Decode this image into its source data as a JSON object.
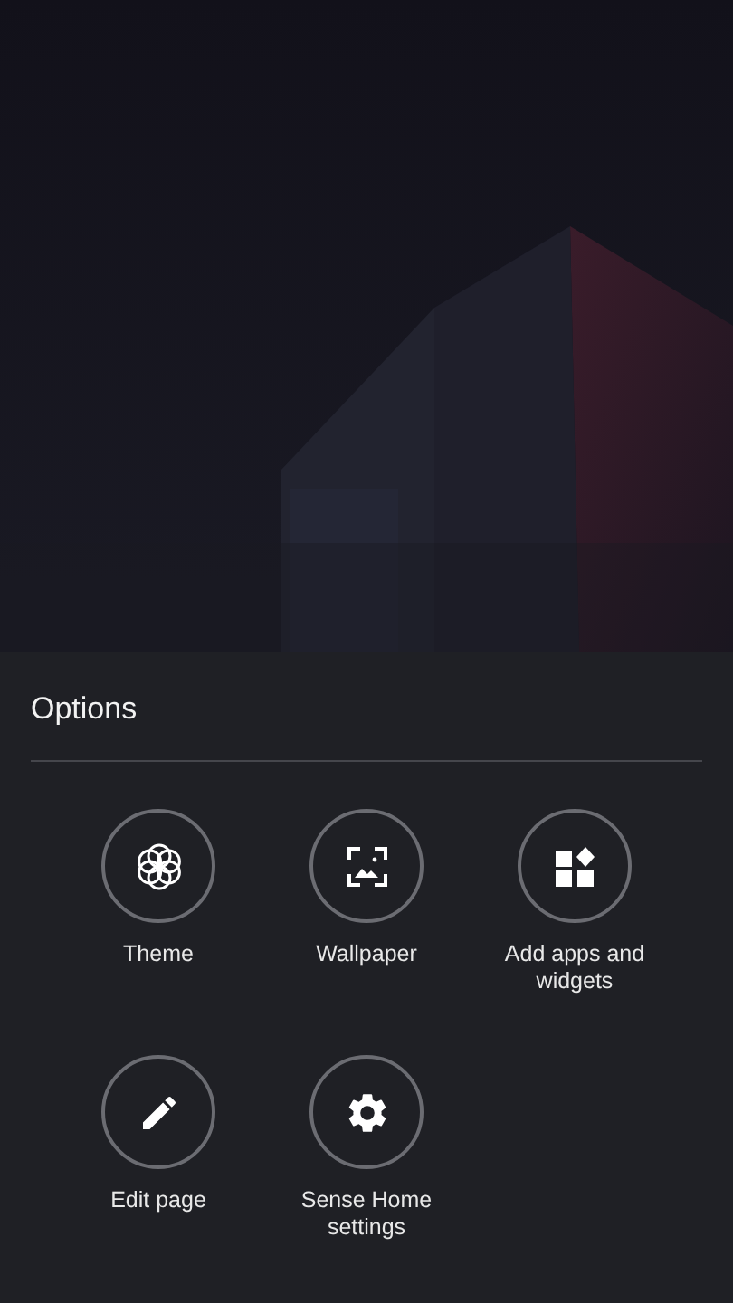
{
  "sheet": {
    "title": "Options",
    "items": [
      {
        "kind": "theme",
        "label": "Theme"
      },
      {
        "kind": "wallpaper",
        "label": "Wallpaper"
      },
      {
        "kind": "widgets",
        "label": "Add apps and widgets"
      },
      {
        "kind": "edit",
        "label": "Edit page"
      },
      {
        "kind": "settings",
        "label": "Sense Home settings"
      }
    ]
  }
}
